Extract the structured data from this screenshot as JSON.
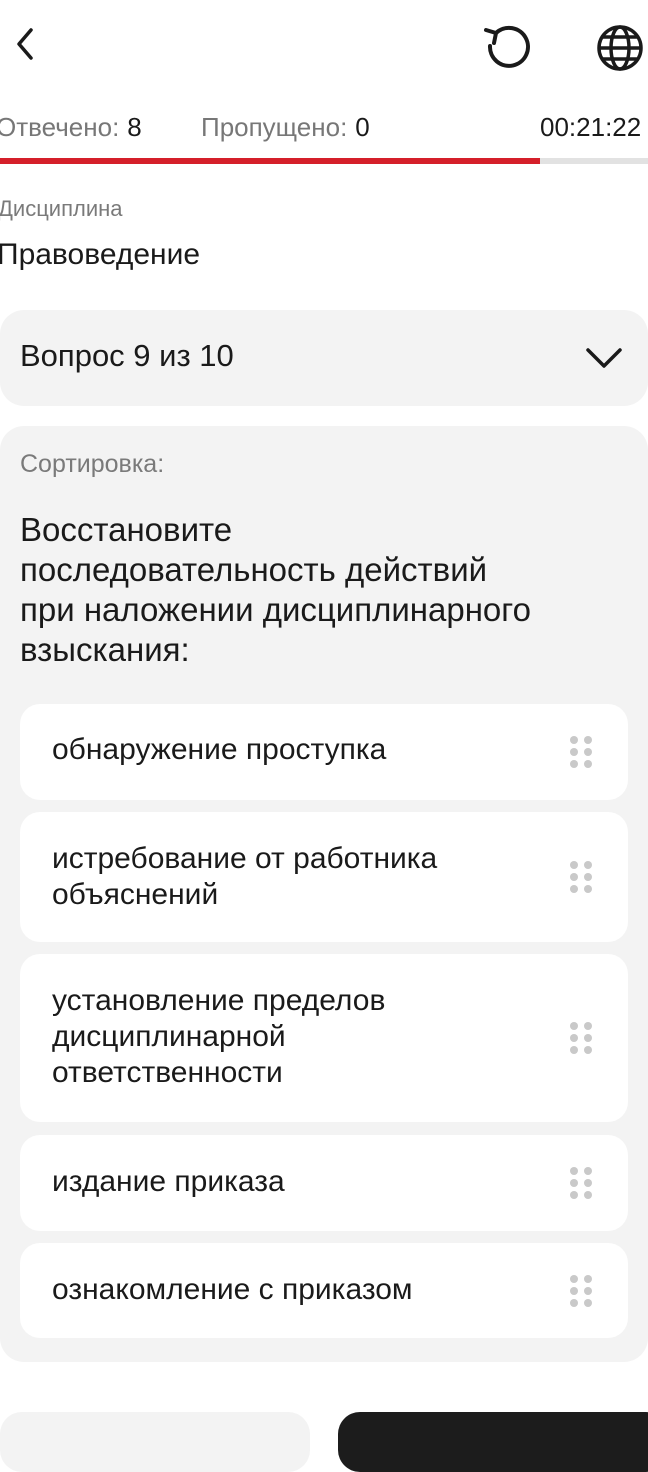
{
  "header": {
    "back_icon": "chevron-left-icon",
    "reset_icon": "undo-icon",
    "language_icon": "globe-icon"
  },
  "stats": {
    "answered_label": "Отвечено:",
    "answered_value": "8",
    "skipped_label": "Пропущено:",
    "skipped_value": "0",
    "timer": "00:21:22"
  },
  "progress": {
    "fraction": 0.8,
    "fill_color": "#d51f2a",
    "track_color": "#e2e2e2"
  },
  "discipline": {
    "label": "Дисциплина",
    "value": "Правоведение"
  },
  "question_selector": {
    "label": "Вопрос 9 из 10",
    "icon": "chevron-down-icon"
  },
  "question": {
    "type_label": "Сортировка:",
    "title_lines": [
      "Восстановите",
      "последовательность действий",
      "при наложении дисциплинарного",
      "взыскания:"
    ],
    "options": [
      {
        "lines": [
          "обнаружение проступка"
        ]
      },
      {
        "lines": [
          "истребование от работника",
          "объяснений"
        ]
      },
      {
        "lines": [
          "установление пределов",
          "дисциплинарной",
          "ответственности"
        ]
      },
      {
        "lines": [
          "издание приказа"
        ]
      },
      {
        "lines": [
          "ознакомление с приказом"
        ]
      }
    ],
    "handle_icon": "drag-handle-icon"
  },
  "footer": {
    "secondary_button_label": "",
    "primary_button_label": ""
  }
}
